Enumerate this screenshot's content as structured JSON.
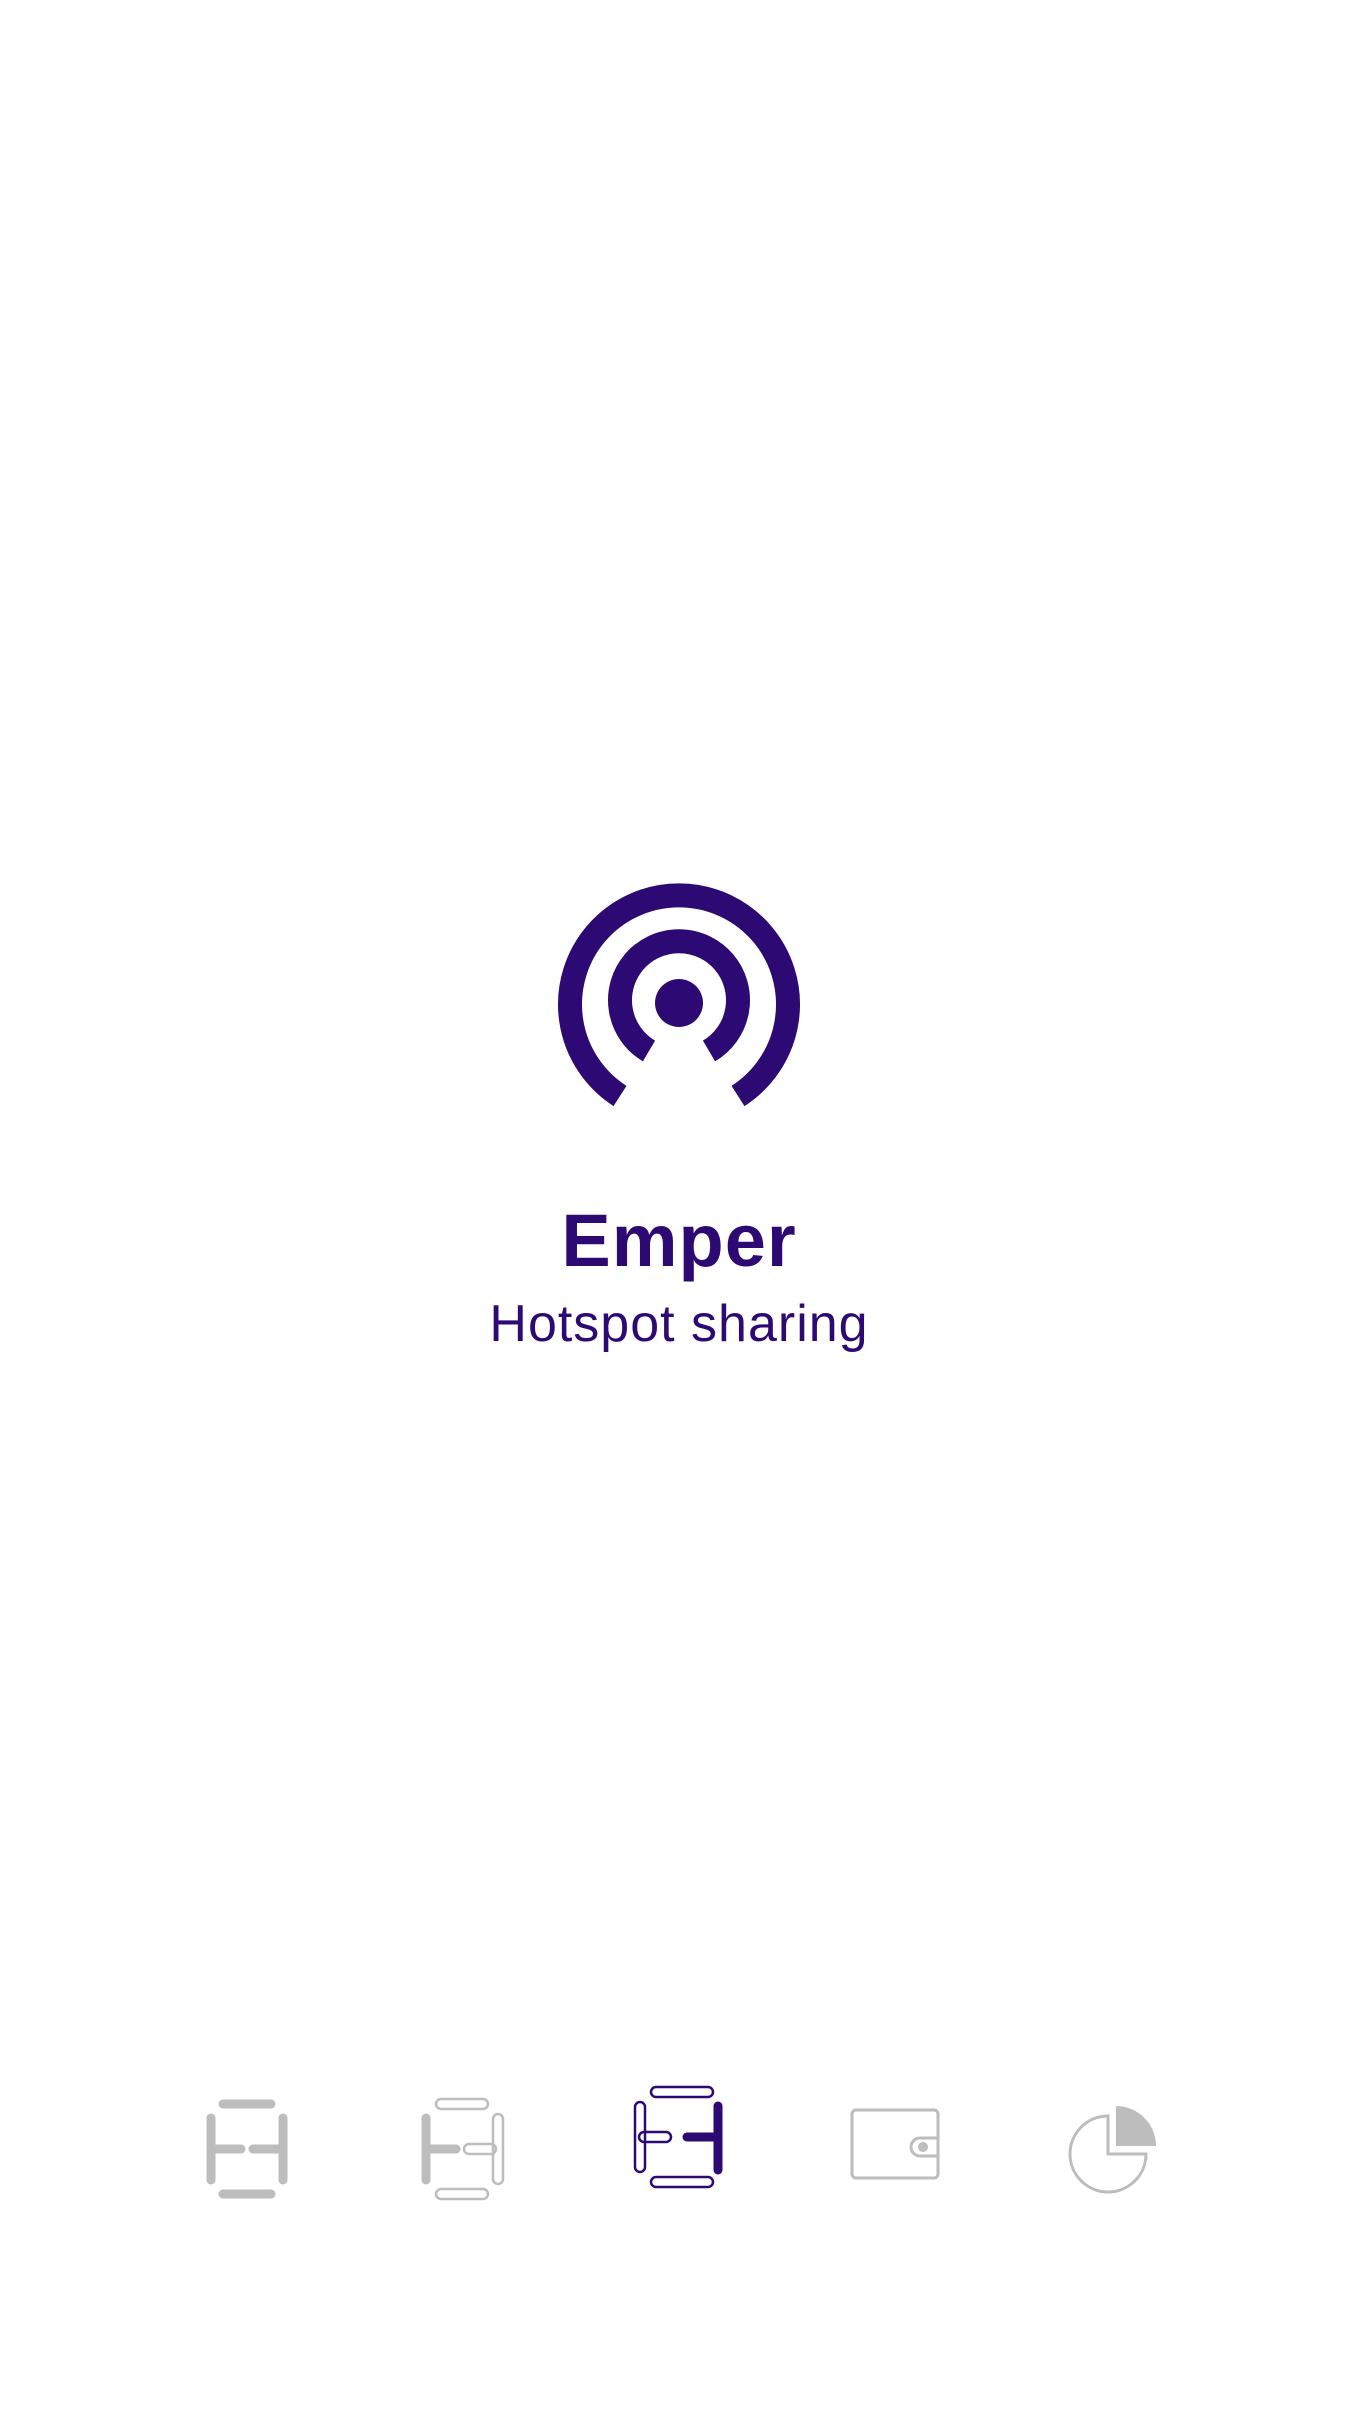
{
  "brand": {
    "title": "Emper",
    "subtitle": "Hotspot sharing",
    "logo_icon": "hotspot-broadcast-icon"
  },
  "tabbar": {
    "items": [
      {
        "icon": "hotspot-grid-filled-icon",
        "active": false
      },
      {
        "icon": "hotspot-grid-half-icon",
        "active": false
      },
      {
        "icon": "hotspot-grid-outline-icon",
        "active": true
      },
      {
        "icon": "wallet-icon",
        "active": false
      },
      {
        "icon": "pie-chart-icon",
        "active": false
      }
    ]
  },
  "colors": {
    "accent": "#2d0a73",
    "inactive": "#bdbdbd",
    "background": "#ffffff"
  }
}
